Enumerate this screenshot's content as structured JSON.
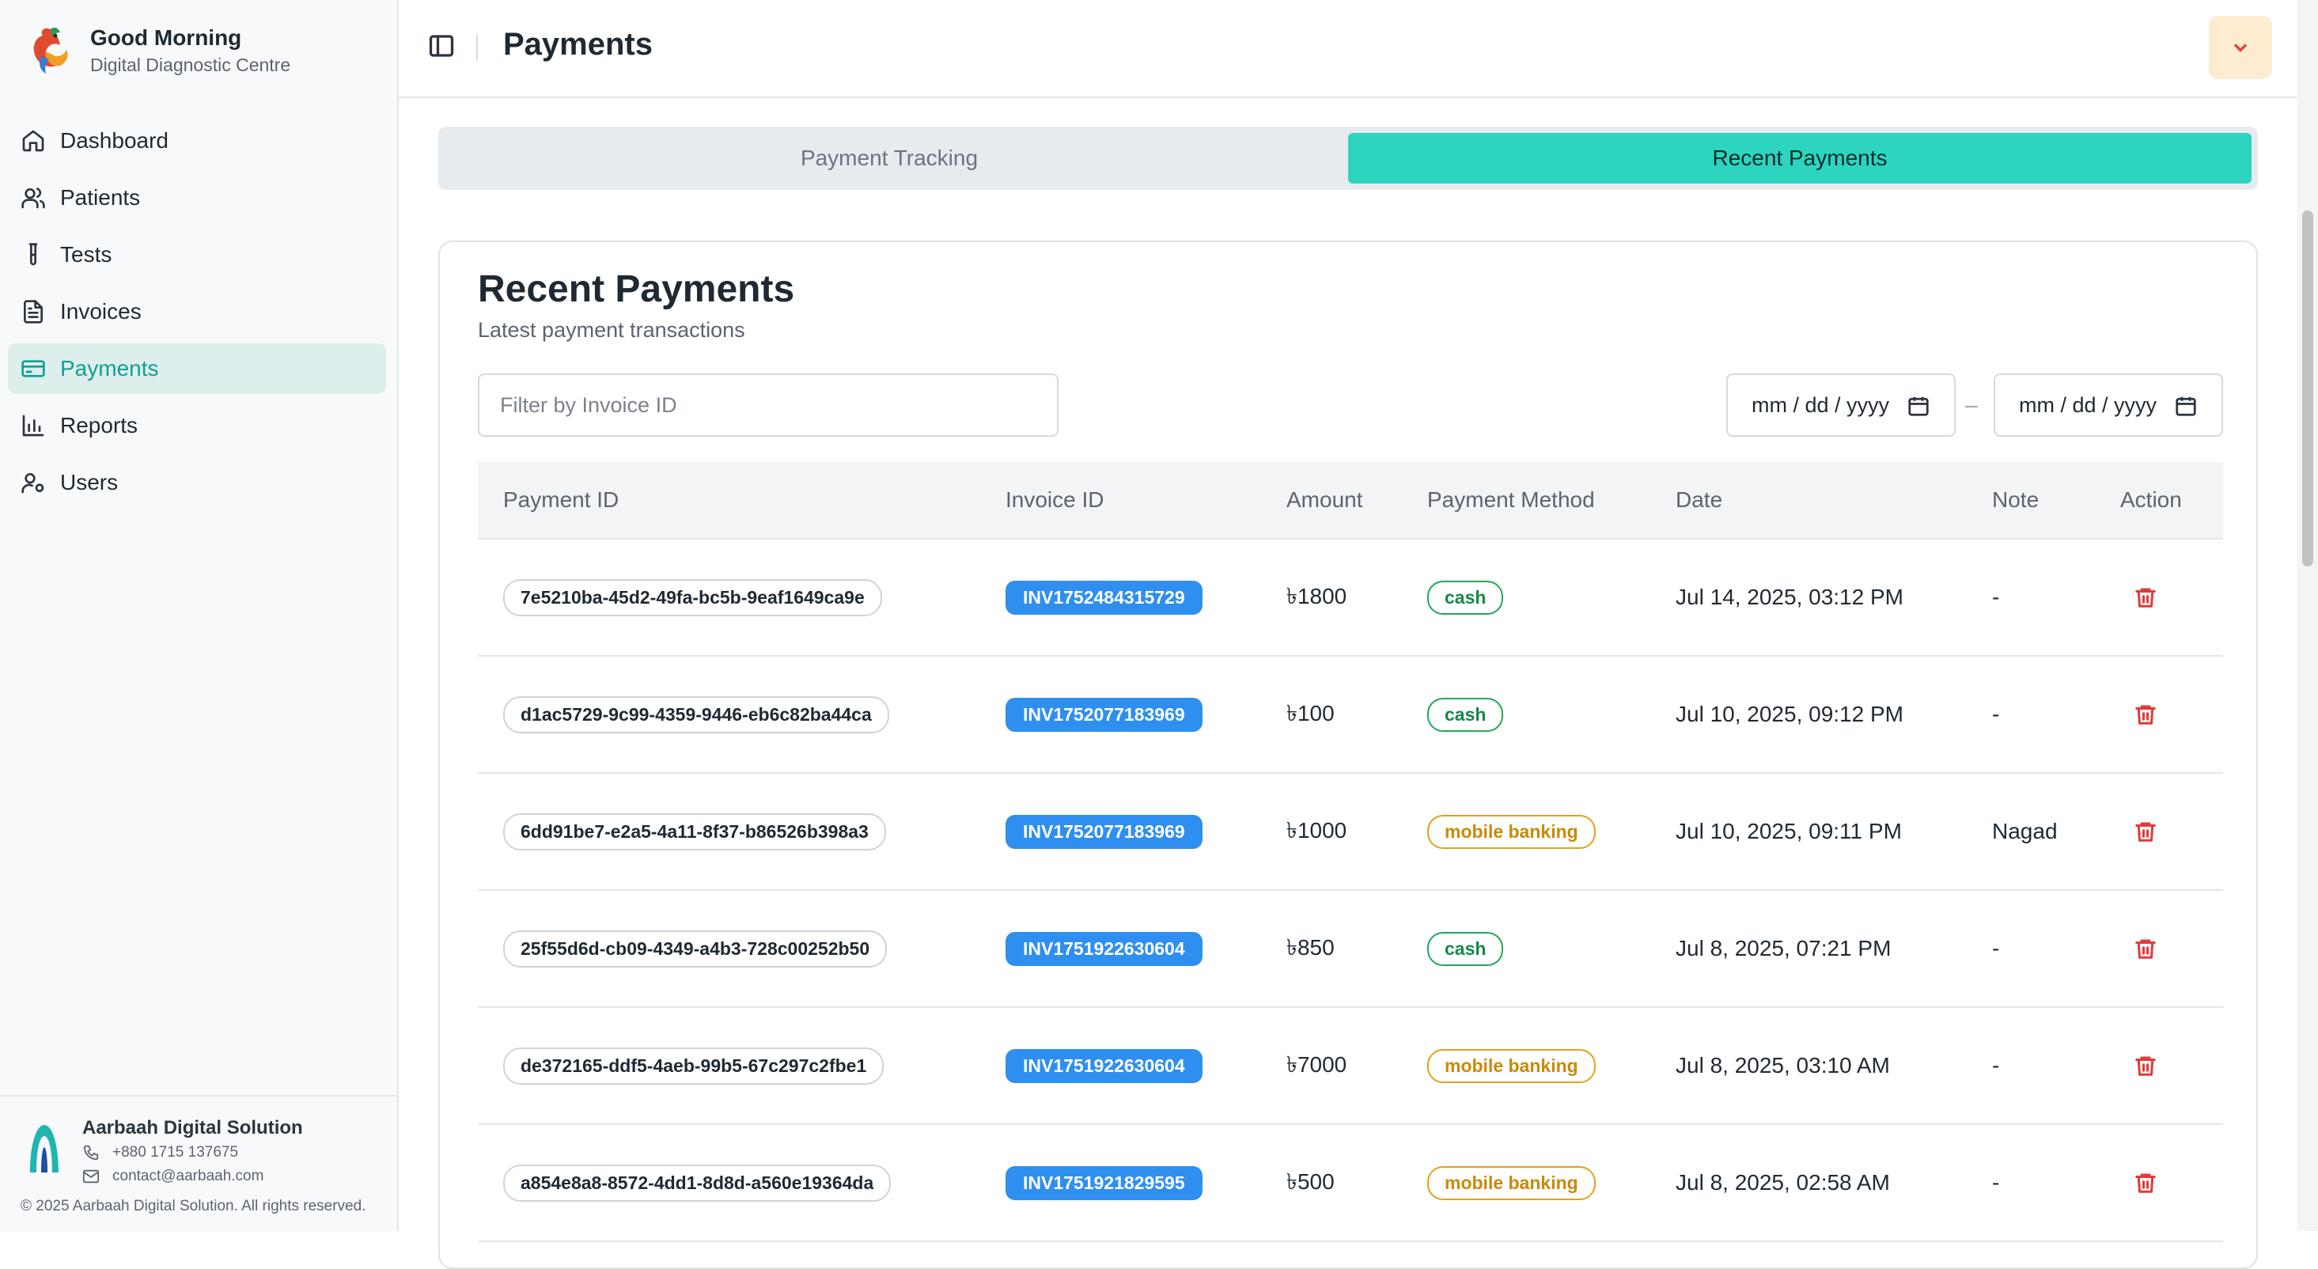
{
  "brand": {
    "title": "Good Morning",
    "subtitle": "Digital Diagnostic Centre"
  },
  "sidebar": {
    "items": [
      {
        "label": "Dashboard",
        "icon": "home-icon"
      },
      {
        "label": "Patients",
        "icon": "users-icon"
      },
      {
        "label": "Tests",
        "icon": "test-tube-icon"
      },
      {
        "label": "Invoices",
        "icon": "document-icon"
      },
      {
        "label": "Payments",
        "icon": "credit-card-icon",
        "active": true
      },
      {
        "label": "Reports",
        "icon": "bar-chart-icon"
      },
      {
        "label": "Users",
        "icon": "user-cog-icon"
      }
    ]
  },
  "footer": {
    "company": "Aarbaah Digital Solution",
    "phone": "+880 1715 137675",
    "email": "contact@aarbaah.com",
    "copyright": "© 2025 Aarbaah Digital Solution. All rights reserved."
  },
  "header": {
    "title": "Payments"
  },
  "tabs": [
    {
      "label": "Payment Tracking",
      "active": false
    },
    {
      "label": "Recent Payments",
      "active": true
    }
  ],
  "card": {
    "title": "Recent Payments",
    "subtitle": "Latest payment transactions",
    "filter_placeholder": "Filter by Invoice ID",
    "date_from": "mm / dd / yyyy",
    "date_separator": "–",
    "date_to": "mm / dd / yyyy"
  },
  "table": {
    "columns": [
      "Payment ID",
      "Invoice ID",
      "Amount",
      "Payment Method",
      "Date",
      "Note",
      "Action"
    ],
    "rows": [
      {
        "payment_id": "7e5210ba-45d2-49fa-bc5b-9eaf1649ca9e",
        "invoice_id": "INV1752484315729",
        "amount": "৳1800",
        "method": "cash",
        "date": "Jul 14, 2025, 03:12 PM",
        "note": "-"
      },
      {
        "payment_id": "d1ac5729-9c99-4359-9446-eb6c82ba44ca",
        "invoice_id": "INV1752077183969",
        "amount": "৳100",
        "method": "cash",
        "date": "Jul 10, 2025, 09:12 PM",
        "note": "-"
      },
      {
        "payment_id": "6dd91be7-e2a5-4a11-8f37-b86526b398a3",
        "invoice_id": "INV1752077183969",
        "amount": "৳1000",
        "method": "mobile banking",
        "date": "Jul 10, 2025, 09:11 PM",
        "note": "Nagad"
      },
      {
        "payment_id": "25f55d6d-cb09-4349-a4b3-728c00252b50",
        "invoice_id": "INV1751922630604",
        "amount": "৳850",
        "method": "cash",
        "date": "Jul 8, 2025, 07:21 PM",
        "note": "-"
      },
      {
        "payment_id": "de372165-ddf5-4aeb-99b5-67c297c2fbe1",
        "invoice_id": "INV1751922630604",
        "amount": "৳7000",
        "method": "mobile banking",
        "date": "Jul 8, 2025, 03:10 AM",
        "note": "-"
      },
      {
        "payment_id": "a854e8a8-8572-4dd1-8d8d-a560e19364da",
        "invoice_id": "INV1751921829595",
        "amount": "৳500",
        "method": "mobile banking",
        "date": "Jul 8, 2025, 02:58 AM",
        "note": "-"
      }
    ]
  },
  "colors": {
    "accent": "#2dd4bf",
    "active_nav": "#149e92",
    "invoice_badge": "#2f8ff0",
    "cash": "#15884a",
    "mobile": "#c98a06",
    "delete": "#e03b3b"
  }
}
